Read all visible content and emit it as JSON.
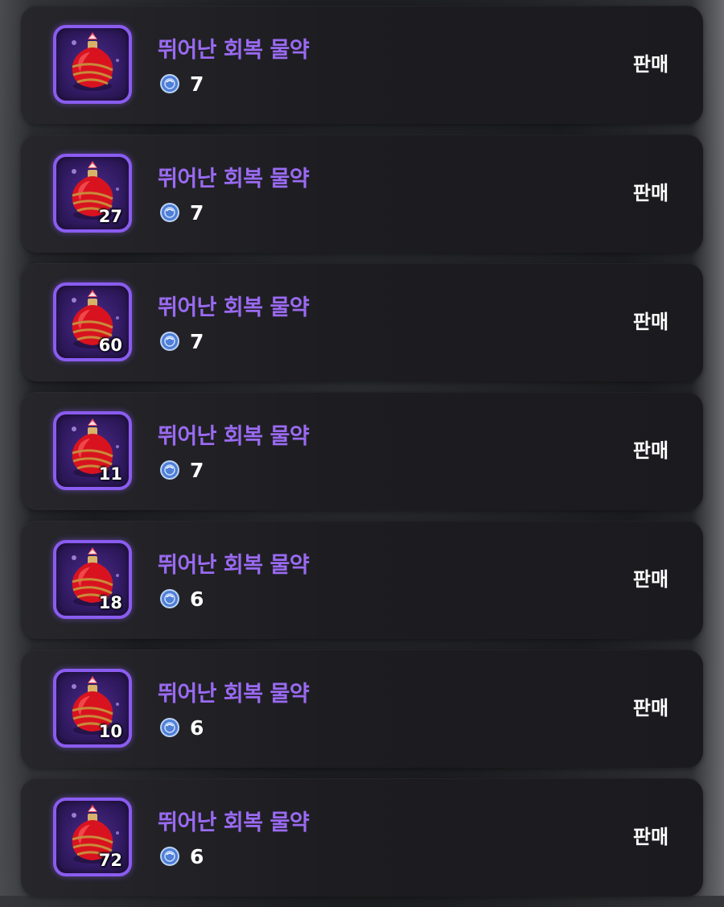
{
  "items": [
    {
      "name": "뛰어난 회복 물약",
      "price": "7",
      "quantity": "",
      "sell_label": "판매",
      "icon": "red-potion-icon"
    },
    {
      "name": "뛰어난 회복 물약",
      "price": "7",
      "quantity": "27",
      "sell_label": "판매",
      "icon": "red-potion-icon"
    },
    {
      "name": "뛰어난 회복 물약",
      "price": "7",
      "quantity": "60",
      "sell_label": "판매",
      "icon": "red-potion-icon"
    },
    {
      "name": "뛰어난 회복 물약",
      "price": "7",
      "quantity": "11",
      "sell_label": "판매",
      "icon": "red-potion-icon"
    },
    {
      "name": "뛰어난 회복 물약",
      "price": "6",
      "quantity": "18",
      "sell_label": "판매",
      "icon": "red-potion-icon"
    },
    {
      "name": "뛰어난 회복 물약",
      "price": "6",
      "quantity": "10",
      "sell_label": "판매",
      "icon": "red-potion-icon"
    },
    {
      "name": "뛰어난 회복 물약",
      "price": "6",
      "quantity": "72",
      "sell_label": "판매",
      "icon": "red-potion-icon"
    }
  ],
  "colors": {
    "item_name": "#9a6af2",
    "icon_border": "#8a5cf0",
    "row_background": "#1d1d21",
    "coin": "#4f7fd6"
  }
}
